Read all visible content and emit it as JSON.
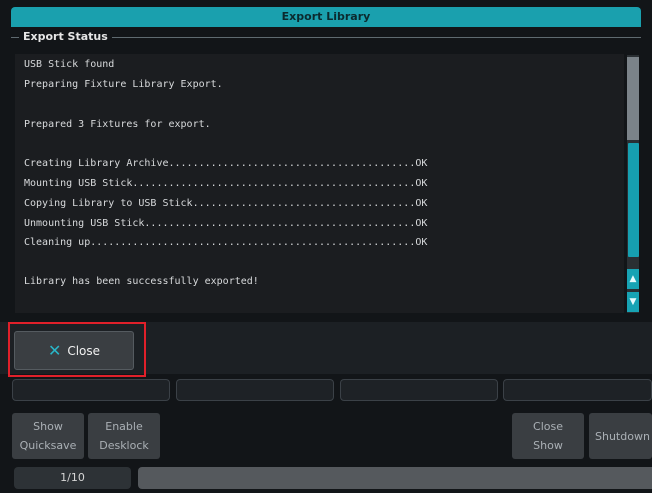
{
  "dialog": {
    "title": "Export Library"
  },
  "export_status": {
    "label": "Export Status",
    "lines": [
      "USB Stick found",
      "Preparing Fixture Library Export.",
      "",
      "Prepared 3 Fixtures for export.",
      "",
      "Creating Library Archive.........................................OK",
      "Mounting USB Stick...............................................OK",
      "Copying Library to USB Stick.....................................OK",
      "Unmounting USB Stick.............................................OK",
      "Cleaning up......................................................OK",
      "",
      "Library has been successfully exported!"
    ]
  },
  "close_button": {
    "label": "Close",
    "icon": "close-icon"
  },
  "function_buttons": {
    "show_quicksave": "Show\nQuicksave",
    "enable_desklock": "Enable\nDesklock",
    "close_show": "Close\nShow",
    "shutdown": "Shutdown"
  },
  "pager": {
    "page": "1/10"
  },
  "colors": {
    "accent": "#1aa0ae",
    "highlight": "#e0202a"
  }
}
